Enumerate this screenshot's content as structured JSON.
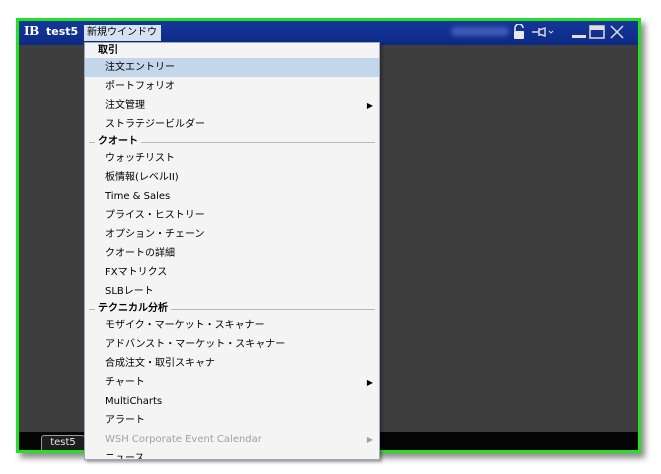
{
  "titlebar": {
    "logo": "IB",
    "window_name": "test5",
    "menu_title": "新規ウインドウ"
  },
  "icons": {
    "lock": "lock-icon",
    "pin": "pin-icon",
    "minimize": "minimize-icon",
    "maximize": "maximize-icon",
    "close": "close-icon"
  },
  "statusbar": {
    "tab_label": "test5"
  },
  "menu": {
    "sec_trading": "取引",
    "order_entry": "注文エントリー",
    "portfolio": "ポートフォリオ",
    "order_management": "注文管理",
    "strategy_builder": "ストラテジービルダー",
    "sec_quote": "クオート",
    "watchlist": "ウォッチリスト",
    "book_trader": "板情報(レベルII)",
    "time_sales": "Time & Sales",
    "price_history": "プライス・ヒストリー",
    "option_chain": "オプション・チェーン",
    "quote_details": "クオートの詳細",
    "fx_matrix": "FXマトリクス",
    "slb_rate": "SLBレート",
    "sec_technical": "テクニカル分析",
    "mosaic_scanner": "モザイク・マーケット・スキャナー",
    "advanced_scanner": "アドバンスト・マーケット・スキャナー",
    "combo_scanner": "合成注文・取引スキャナ",
    "chart": "チャート",
    "multicharts": "MultiCharts",
    "alert": "アラート",
    "wsh_calendar": "WSH Corporate Event Calendar",
    "cut_off": "ニュース"
  },
  "colors": {
    "accent_frame": "#22e022",
    "titlebar": "#0c2a84",
    "highlight": "#c4d6ea"
  }
}
